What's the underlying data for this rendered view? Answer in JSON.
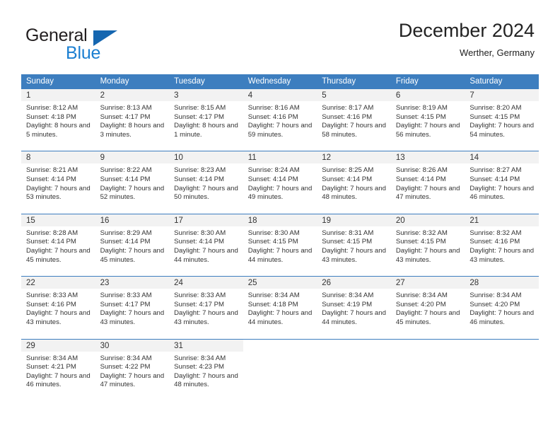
{
  "brand": {
    "name_top": "General",
    "name_bottom": "Blue"
  },
  "header": {
    "title": "December 2024",
    "subtitle": "Werther, Germany"
  },
  "colors": {
    "header_blue": "#3d7ebf",
    "brand_blue": "#1b7fd1",
    "day_strip": "#f2f2f2",
    "text": "#333333"
  },
  "weekdays": [
    "Sunday",
    "Monday",
    "Tuesday",
    "Wednesday",
    "Thursday",
    "Friday",
    "Saturday"
  ],
  "weeks": [
    [
      {
        "day": "1",
        "sunrise": "Sunrise: 8:12 AM",
        "sunset": "Sunset: 4:18 PM",
        "daylight": "Daylight: 8 hours and 5 minutes."
      },
      {
        "day": "2",
        "sunrise": "Sunrise: 8:13 AM",
        "sunset": "Sunset: 4:17 PM",
        "daylight": "Daylight: 8 hours and 3 minutes."
      },
      {
        "day": "3",
        "sunrise": "Sunrise: 8:15 AM",
        "sunset": "Sunset: 4:17 PM",
        "daylight": "Daylight: 8 hours and 1 minute."
      },
      {
        "day": "4",
        "sunrise": "Sunrise: 8:16 AM",
        "sunset": "Sunset: 4:16 PM",
        "daylight": "Daylight: 7 hours and 59 minutes."
      },
      {
        "day": "5",
        "sunrise": "Sunrise: 8:17 AM",
        "sunset": "Sunset: 4:16 PM",
        "daylight": "Daylight: 7 hours and 58 minutes."
      },
      {
        "day": "6",
        "sunrise": "Sunrise: 8:19 AM",
        "sunset": "Sunset: 4:15 PM",
        "daylight": "Daylight: 7 hours and 56 minutes."
      },
      {
        "day": "7",
        "sunrise": "Sunrise: 8:20 AM",
        "sunset": "Sunset: 4:15 PM",
        "daylight": "Daylight: 7 hours and 54 minutes."
      }
    ],
    [
      {
        "day": "8",
        "sunrise": "Sunrise: 8:21 AM",
        "sunset": "Sunset: 4:14 PM",
        "daylight": "Daylight: 7 hours and 53 minutes."
      },
      {
        "day": "9",
        "sunrise": "Sunrise: 8:22 AM",
        "sunset": "Sunset: 4:14 PM",
        "daylight": "Daylight: 7 hours and 52 minutes."
      },
      {
        "day": "10",
        "sunrise": "Sunrise: 8:23 AM",
        "sunset": "Sunset: 4:14 PM",
        "daylight": "Daylight: 7 hours and 50 minutes."
      },
      {
        "day": "11",
        "sunrise": "Sunrise: 8:24 AM",
        "sunset": "Sunset: 4:14 PM",
        "daylight": "Daylight: 7 hours and 49 minutes."
      },
      {
        "day": "12",
        "sunrise": "Sunrise: 8:25 AM",
        "sunset": "Sunset: 4:14 PM",
        "daylight": "Daylight: 7 hours and 48 minutes."
      },
      {
        "day": "13",
        "sunrise": "Sunrise: 8:26 AM",
        "sunset": "Sunset: 4:14 PM",
        "daylight": "Daylight: 7 hours and 47 minutes."
      },
      {
        "day": "14",
        "sunrise": "Sunrise: 8:27 AM",
        "sunset": "Sunset: 4:14 PM",
        "daylight": "Daylight: 7 hours and 46 minutes."
      }
    ],
    [
      {
        "day": "15",
        "sunrise": "Sunrise: 8:28 AM",
        "sunset": "Sunset: 4:14 PM",
        "daylight": "Daylight: 7 hours and 45 minutes."
      },
      {
        "day": "16",
        "sunrise": "Sunrise: 8:29 AM",
        "sunset": "Sunset: 4:14 PM",
        "daylight": "Daylight: 7 hours and 45 minutes."
      },
      {
        "day": "17",
        "sunrise": "Sunrise: 8:30 AM",
        "sunset": "Sunset: 4:14 PM",
        "daylight": "Daylight: 7 hours and 44 minutes."
      },
      {
        "day": "18",
        "sunrise": "Sunrise: 8:30 AM",
        "sunset": "Sunset: 4:15 PM",
        "daylight": "Daylight: 7 hours and 44 minutes."
      },
      {
        "day": "19",
        "sunrise": "Sunrise: 8:31 AM",
        "sunset": "Sunset: 4:15 PM",
        "daylight": "Daylight: 7 hours and 43 minutes."
      },
      {
        "day": "20",
        "sunrise": "Sunrise: 8:32 AM",
        "sunset": "Sunset: 4:15 PM",
        "daylight": "Daylight: 7 hours and 43 minutes."
      },
      {
        "day": "21",
        "sunrise": "Sunrise: 8:32 AM",
        "sunset": "Sunset: 4:16 PM",
        "daylight": "Daylight: 7 hours and 43 minutes."
      }
    ],
    [
      {
        "day": "22",
        "sunrise": "Sunrise: 8:33 AM",
        "sunset": "Sunset: 4:16 PM",
        "daylight": "Daylight: 7 hours and 43 minutes."
      },
      {
        "day": "23",
        "sunrise": "Sunrise: 8:33 AM",
        "sunset": "Sunset: 4:17 PM",
        "daylight": "Daylight: 7 hours and 43 minutes."
      },
      {
        "day": "24",
        "sunrise": "Sunrise: 8:33 AM",
        "sunset": "Sunset: 4:17 PM",
        "daylight": "Daylight: 7 hours and 43 minutes."
      },
      {
        "day": "25",
        "sunrise": "Sunrise: 8:34 AM",
        "sunset": "Sunset: 4:18 PM",
        "daylight": "Daylight: 7 hours and 44 minutes."
      },
      {
        "day": "26",
        "sunrise": "Sunrise: 8:34 AM",
        "sunset": "Sunset: 4:19 PM",
        "daylight": "Daylight: 7 hours and 44 minutes."
      },
      {
        "day": "27",
        "sunrise": "Sunrise: 8:34 AM",
        "sunset": "Sunset: 4:20 PM",
        "daylight": "Daylight: 7 hours and 45 minutes."
      },
      {
        "day": "28",
        "sunrise": "Sunrise: 8:34 AM",
        "sunset": "Sunset: 4:20 PM",
        "daylight": "Daylight: 7 hours and 46 minutes."
      }
    ],
    [
      {
        "day": "29",
        "sunrise": "Sunrise: 8:34 AM",
        "sunset": "Sunset: 4:21 PM",
        "daylight": "Daylight: 7 hours and 46 minutes."
      },
      {
        "day": "30",
        "sunrise": "Sunrise: 8:34 AM",
        "sunset": "Sunset: 4:22 PM",
        "daylight": "Daylight: 7 hours and 47 minutes."
      },
      {
        "day": "31",
        "sunrise": "Sunrise: 8:34 AM",
        "sunset": "Sunset: 4:23 PM",
        "daylight": "Daylight: 7 hours and 48 minutes."
      },
      {
        "day": "",
        "sunrise": "",
        "sunset": "",
        "daylight": ""
      },
      {
        "day": "",
        "sunrise": "",
        "sunset": "",
        "daylight": ""
      },
      {
        "day": "",
        "sunrise": "",
        "sunset": "",
        "daylight": ""
      },
      {
        "day": "",
        "sunrise": "",
        "sunset": "",
        "daylight": ""
      }
    ]
  ]
}
